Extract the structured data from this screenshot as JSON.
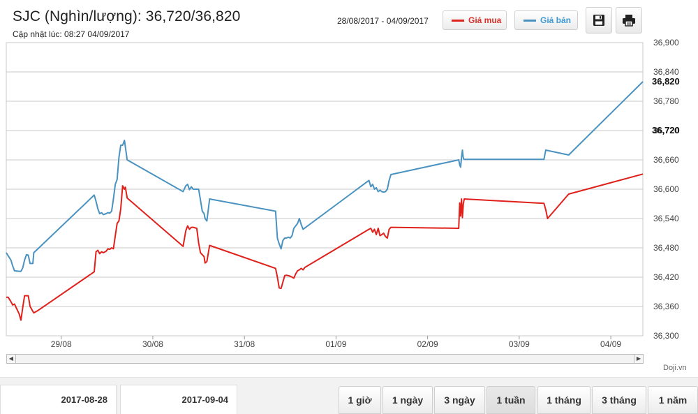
{
  "header": {
    "title": "SJC (Nghìn/lượng): 36,720/36,820",
    "updated": "Cập nhật lúc: 08:27 04/09/2017",
    "range": "28/08/2017 - 04/09/2017"
  },
  "legend": {
    "buy_label": "Giá mua",
    "sell_label": "Giá bán",
    "buy_color": "#e0201b",
    "sell_color": "#4a92c0"
  },
  "toolbar": {
    "save_icon": "floppy-disk-icon",
    "print_icon": "printer-icon"
  },
  "credit": "Doji.vn",
  "date_range": {
    "from": "2017-08-28",
    "to": "2017-09-04"
  },
  "periods": [
    {
      "label": "1 giờ",
      "active": false
    },
    {
      "label": "1 ngày",
      "active": false
    },
    {
      "label": "3 ngày",
      "active": false
    },
    {
      "label": "1 tuần",
      "active": true
    },
    {
      "label": "1 tháng",
      "active": false
    },
    {
      "label": "3 tháng",
      "active": false
    },
    {
      "label": "1 năm",
      "active": false
    }
  ],
  "chart_data": {
    "type": "line",
    "x_unit": "day",
    "x_ticks": [
      {
        "x": 1,
        "label": "29/08"
      },
      {
        "x": 2,
        "label": "30/08"
      },
      {
        "x": 3,
        "label": "31/08"
      },
      {
        "x": 4,
        "label": "01/09"
      },
      {
        "x": 5,
        "label": "02/09"
      },
      {
        "x": 6,
        "label": "03/09"
      },
      {
        "x": 7,
        "label": "04/09"
      }
    ],
    "xlim": [
      0.4,
      7.35
    ],
    "ylim": [
      36300,
      36900
    ],
    "y_ticks": [
      36300,
      36360,
      36420,
      36480,
      36540,
      36600,
      36660,
      36720,
      36780,
      36840,
      36900
    ],
    "y_tick_labels": [
      "36,300",
      "36,360",
      "36,420",
      "36,480",
      "36,540",
      "36,600",
      "36,660",
      "36,720",
      "36,780",
      "36,840",
      "36,900"
    ],
    "current_labels": [
      {
        "value": 36720,
        "label": "36,720"
      },
      {
        "value": 36820,
        "label": "36,820"
      }
    ],
    "grid": true,
    "series": [
      {
        "name": "Giá mua",
        "color": "#e0201b",
        "points": [
          [
            0.4,
            36379
          ],
          [
            0.42,
            36379
          ],
          [
            0.45,
            36370
          ],
          [
            0.47,
            36363
          ],
          [
            0.49,
            36365
          ],
          [
            0.51,
            36357
          ],
          [
            0.54,
            36345
          ],
          [
            0.56,
            36332
          ],
          [
            0.58,
            36358
          ],
          [
            0.6,
            36382
          ],
          [
            0.62,
            36382
          ],
          [
            0.64,
            36382
          ],
          [
            0.66,
            36360
          ],
          [
            0.69,
            36350
          ],
          [
            0.7,
            36347
          ],
          [
            0.74,
            36351
          ],
          [
            1.36,
            36431
          ],
          [
            1.38,
            36472
          ],
          [
            1.4,
            36475
          ],
          [
            1.42,
            36468
          ],
          [
            1.44,
            36472
          ],
          [
            1.46,
            36470
          ],
          [
            1.49,
            36473
          ],
          [
            1.51,
            36478
          ],
          [
            1.53,
            36477
          ],
          [
            1.55,
            36480
          ],
          [
            1.57,
            36478
          ],
          [
            1.59,
            36505
          ],
          [
            1.61,
            36530
          ],
          [
            1.63,
            36535
          ],
          [
            1.65,
            36560
          ],
          [
            1.67,
            36607
          ],
          [
            1.69,
            36600
          ],
          [
            1.7,
            36604
          ],
          [
            1.72,
            36582
          ],
          [
            2.33,
            36483
          ],
          [
            2.36,
            36515
          ],
          [
            2.38,
            36525
          ],
          [
            2.4,
            36518
          ],
          [
            2.42,
            36522
          ],
          [
            2.44,
            36522
          ],
          [
            2.48,
            36520
          ],
          [
            2.5,
            36490
          ],
          [
            2.52,
            36470
          ],
          [
            2.54,
            36466
          ],
          [
            2.56,
            36462
          ],
          [
            2.57,
            36449
          ],
          [
            2.59,
            36452
          ],
          [
            2.62,
            36485
          ],
          [
            3.34,
            36438
          ],
          [
            3.36,
            36420
          ],
          [
            3.38,
            36398
          ],
          [
            3.4,
            36397
          ],
          [
            3.42,
            36410
          ],
          [
            3.44,
            36423
          ],
          [
            3.46,
            36424
          ],
          [
            3.48,
            36423
          ],
          [
            3.5,
            36422
          ],
          [
            3.52,
            36420
          ],
          [
            3.54,
            36418
          ],
          [
            3.56,
            36427
          ],
          [
            3.58,
            36433
          ],
          [
            3.6,
            36435
          ],
          [
            3.62,
            36438
          ],
          [
            3.64,
            36435
          ],
          [
            3.66,
            36440
          ],
          [
            4.36,
            36518
          ],
          [
            4.38,
            36520
          ],
          [
            4.4,
            36512
          ],
          [
            4.42,
            36518
          ],
          [
            4.44,
            36507
          ],
          [
            4.46,
            36520
          ],
          [
            4.48,
            36505
          ],
          [
            4.5,
            36507
          ],
          [
            4.52,
            36510
          ],
          [
            4.54,
            36503
          ],
          [
            4.56,
            36500
          ],
          [
            4.58,
            36518
          ],
          [
            4.6,
            36522
          ],
          [
            5.34,
            36520
          ],
          [
            5.35,
            36572
          ],
          [
            5.36,
            36545
          ],
          [
            5.37,
            36580
          ],
          [
            5.38,
            36542
          ],
          [
            5.39,
            36570
          ],
          [
            5.4,
            36580
          ],
          [
            6.27,
            36571
          ],
          [
            6.29,
            36558
          ],
          [
            6.31,
            36540
          ],
          [
            6.54,
            36590
          ],
          [
            7.35,
            36631
          ]
        ]
      },
      {
        "name": "Giá bán",
        "color": "#4a92c0",
        "points": [
          [
            0.4,
            36470
          ],
          [
            0.42,
            36464
          ],
          [
            0.45,
            36455
          ],
          [
            0.47,
            36443
          ],
          [
            0.49,
            36433
          ],
          [
            0.54,
            36432
          ],
          [
            0.56,
            36432
          ],
          [
            0.58,
            36439
          ],
          [
            0.6,
            36455
          ],
          [
            0.62,
            36466
          ],
          [
            0.64,
            36465
          ],
          [
            0.66,
            36448
          ],
          [
            0.69,
            36448
          ],
          [
            0.7,
            36470
          ],
          [
            1.36,
            36588
          ],
          [
            1.38,
            36575
          ],
          [
            1.4,
            36560
          ],
          [
            1.42,
            36550
          ],
          [
            1.44,
            36552
          ],
          [
            1.46,
            36548
          ],
          [
            1.49,
            36550
          ],
          [
            1.51,
            36552
          ],
          [
            1.53,
            36551
          ],
          [
            1.55,
            36555
          ],
          [
            1.57,
            36580
          ],
          [
            1.59,
            36610
          ],
          [
            1.61,
            36620
          ],
          [
            1.63,
            36665
          ],
          [
            1.65,
            36690
          ],
          [
            1.67,
            36690
          ],
          [
            1.69,
            36700
          ],
          [
            1.72,
            36660
          ],
          [
            2.33,
            36595
          ],
          [
            2.36,
            36607
          ],
          [
            2.38,
            36610
          ],
          [
            2.4,
            36599
          ],
          [
            2.42,
            36605
          ],
          [
            2.44,
            36600
          ],
          [
            2.48,
            36600
          ],
          [
            2.5,
            36600
          ],
          [
            2.52,
            36578
          ],
          [
            2.54,
            36555
          ],
          [
            2.56,
            36550
          ],
          [
            2.57,
            36540
          ],
          [
            2.59,
            36535
          ],
          [
            2.62,
            36580
          ],
          [
            3.34,
            36555
          ],
          [
            3.36,
            36500
          ],
          [
            3.38,
            36488
          ],
          [
            3.4,
            36478
          ],
          [
            3.42,
            36495
          ],
          [
            3.44,
            36500
          ],
          [
            3.46,
            36500
          ],
          [
            3.48,
            36502
          ],
          [
            3.5,
            36500
          ],
          [
            3.52,
            36505
          ],
          [
            3.54,
            36520
          ],
          [
            3.56,
            36525
          ],
          [
            3.58,
            36530
          ],
          [
            3.6,
            36540
          ],
          [
            3.62,
            36528
          ],
          [
            3.64,
            36518
          ],
          [
            4.36,
            36618
          ],
          [
            4.38,
            36605
          ],
          [
            4.4,
            36610
          ],
          [
            4.42,
            36600
          ],
          [
            4.44,
            36603
          ],
          [
            4.46,
            36595
          ],
          [
            4.48,
            36598
          ],
          [
            4.5,
            36595
          ],
          [
            4.52,
            36594
          ],
          [
            4.54,
            36595
          ],
          [
            4.56,
            36600
          ],
          [
            4.58,
            36618
          ],
          [
            4.6,
            36630
          ],
          [
            5.34,
            36660
          ],
          [
            5.35,
            36650
          ],
          [
            5.36,
            36645
          ],
          [
            5.37,
            36665
          ],
          [
            5.38,
            36680
          ],
          [
            5.39,
            36663
          ],
          [
            5.4,
            36661
          ],
          [
            6.27,
            36661
          ],
          [
            6.29,
            36680
          ],
          [
            6.54,
            36670
          ],
          [
            7.35,
            36820
          ]
        ]
      }
    ]
  }
}
